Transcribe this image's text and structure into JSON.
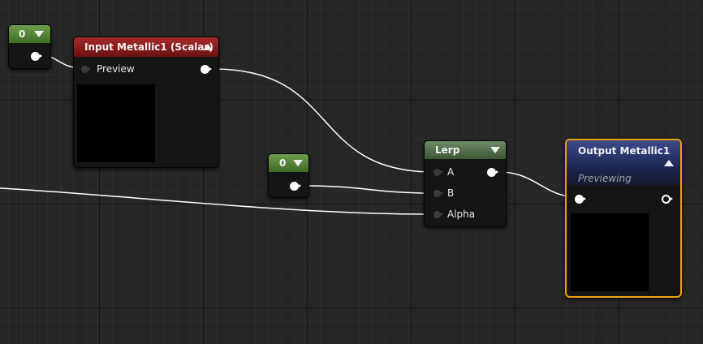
{
  "constants": [
    {
      "value": "0"
    },
    {
      "value": "0"
    }
  ],
  "input_node": {
    "title": "Input Metallic1 (Scalar)",
    "pin_label": "Preview"
  },
  "lerp_node": {
    "title": "Lerp",
    "inputs": [
      "A",
      "B",
      "Alpha"
    ]
  },
  "output_node": {
    "title": "Output Metallic1",
    "subtitle": "Previewing"
  },
  "colors": {
    "canvas": "#262626",
    "constant_header": "#4a7a2f",
    "input_header": "#8a1d1d",
    "lerp_header": "#4f6a48",
    "output_header": "#27336b",
    "selection": "#f0a000",
    "wire": "#ffffff"
  },
  "icons": {
    "collapse": "triangle-down",
    "expand": "triangle-up",
    "output_pin": "filled-circle-arrow",
    "preview_toggle_pin": "hollow-circle-arrow"
  }
}
